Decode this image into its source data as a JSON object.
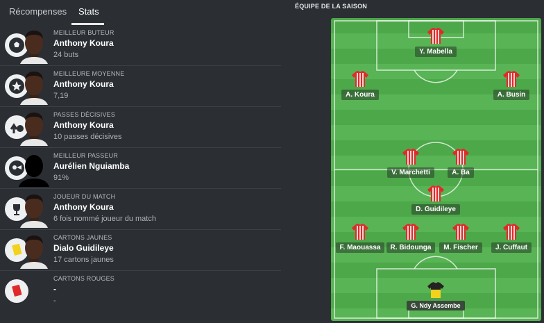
{
  "tabs": [
    {
      "label": "Récompenses"
    },
    {
      "label": "Stats"
    }
  ],
  "awards": [
    {
      "category": "MEILLEUR BUTEUR",
      "name": "Anthony Koura",
      "value": "24 buts",
      "icon": "football-icon"
    },
    {
      "category": "MEILLEURE MOYENNE",
      "name": "Anthony Koura",
      "value": "7,19",
      "icon": "star-icon"
    },
    {
      "category": "PASSES DÉCISIVES",
      "name": "Anthony Koura",
      "value": "10 passes décisives",
      "icon": "assist-boot-icon"
    },
    {
      "category": "MEILLEUR PASSEUR",
      "name": "Aurélien Nguiamba",
      "value": "91%",
      "icon": "pass-icon"
    },
    {
      "category": "JOUEUR DU MATCH",
      "name": "Anthony Koura",
      "value": "6 fois nommé joueur du match",
      "icon": "trophy-icon"
    },
    {
      "category": "CARTONS JAUNES",
      "name": "Dialo Guidileye",
      "value": "17 cartons jaunes",
      "icon": "yellow-card-icon"
    },
    {
      "category": "CARTONS ROUGES",
      "name": "-",
      "value": "-",
      "icon": "red-card-icon"
    }
  ],
  "team_of_season": {
    "title": "ÉQUIPE DE LA SAISON",
    "players": [
      {
        "name": "Y. Mabella",
        "role": "ST"
      },
      {
        "name": "A. Koura",
        "role": "LW"
      },
      {
        "name": "A. Busin",
        "role": "RW"
      },
      {
        "name": "V. Marchetti",
        "role": "CM"
      },
      {
        "name": "A. Ba",
        "role": "CM"
      },
      {
        "name": "D. Guidileye",
        "role": "DM"
      },
      {
        "name": "F. Maouassa",
        "role": "LB"
      },
      {
        "name": "R. Bidounga",
        "role": "CB"
      },
      {
        "name": "M. Fischer",
        "role": "CB"
      },
      {
        "name": "J. Cuffaut",
        "role": "RB"
      },
      {
        "name": "G. Ndy Assembe",
        "role": "GK"
      }
    ]
  },
  "colors": {
    "background": "#2b2f34",
    "pitch_light": "#58b454",
    "pitch_dark": "#4da84a",
    "shirt_red": "#e02a2a",
    "gk_yellow": "#f2d21c"
  }
}
